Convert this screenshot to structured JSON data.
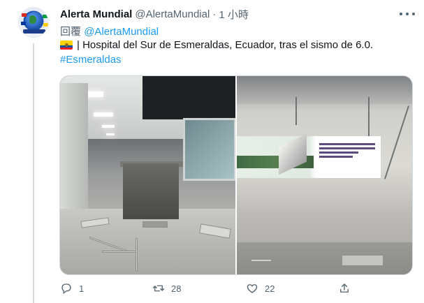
{
  "tweet": {
    "display_name": "Alerta Mundial",
    "handle": "@AlertaMundial",
    "separator": "·",
    "timestamp": "1 小時",
    "reply_prefix": "回覆",
    "reply_to": "@AlertaMundial",
    "flag_icon": "ecuador-flag-icon",
    "text": "| Hospital del Sur de Esmeraldas, Ecuador, tras el sismo de 6.0.",
    "hashtag": "#Esmeraldas"
  },
  "media": {
    "images": [
      {
        "name": "hospital-interior-photo"
      },
      {
        "name": "hospital-wall-photo"
      }
    ]
  },
  "actions": {
    "reply_count": "1",
    "retweet_count": "28",
    "like_count": "22",
    "share_count": ""
  },
  "colors": {
    "link": "#1d9bf0",
    "secondary_text": "#536471",
    "primary_text": "#0f1419"
  }
}
